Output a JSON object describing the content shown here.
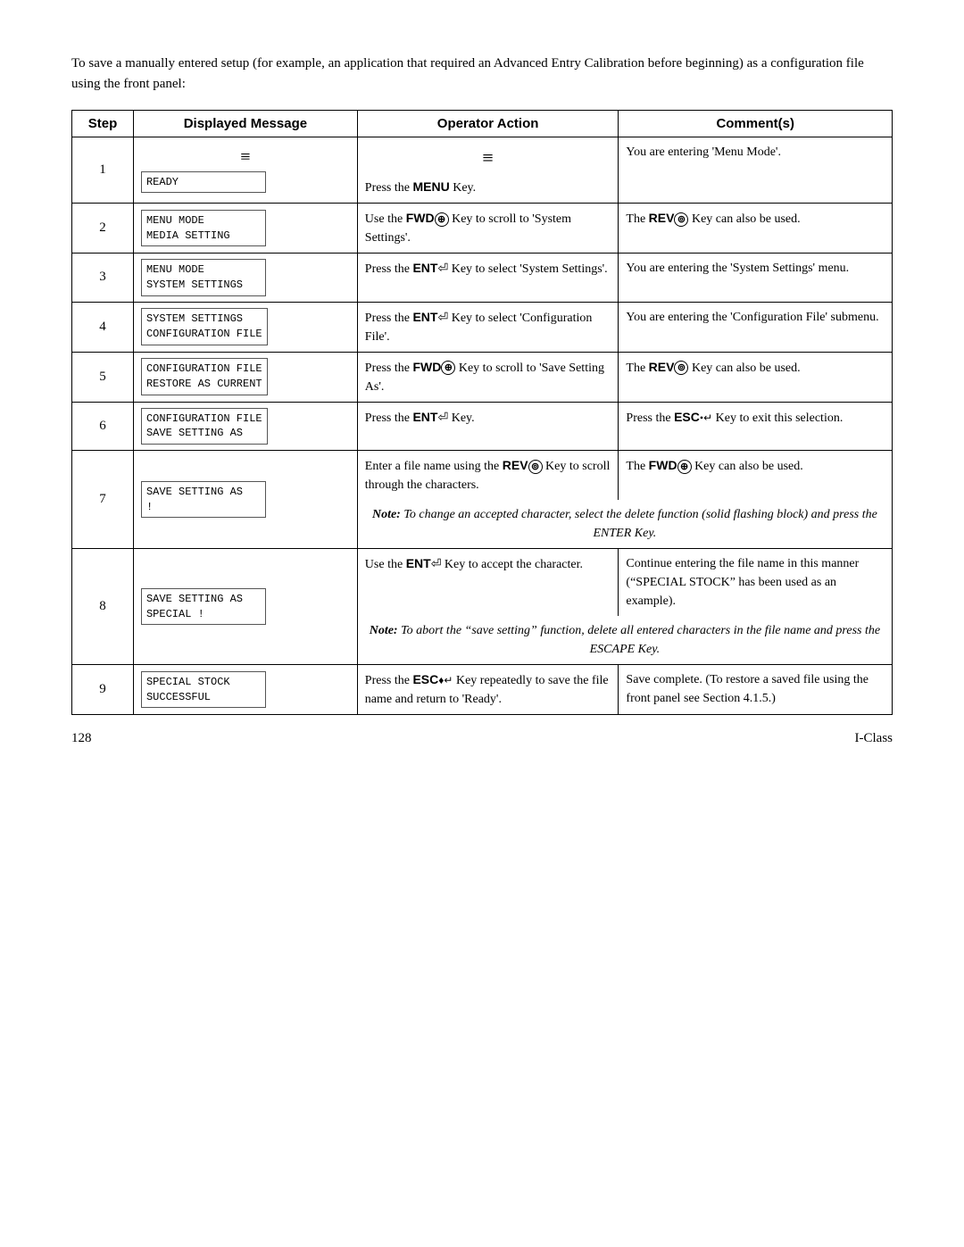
{
  "intro": {
    "text": "To save a manually entered setup (for example, an application that required an Advanced Entry Calibration before beginning) as a configuration file using the front panel:"
  },
  "table": {
    "headers": {
      "step": "Step",
      "display": "Displayed Message",
      "operator": "Operator Action",
      "comment": "Comment(s)"
    },
    "rows": [
      {
        "step": "1",
        "display_lines": [
          "READY"
        ],
        "operator": "Press the MENU Key.",
        "operator_prefix": "",
        "comment": "You are entering 'Menu Mode'.",
        "has_note": false
      },
      {
        "step": "2",
        "display_lines": [
          "MENU MODE",
          "MEDIA SETTING"
        ],
        "operator": "Use the FWD Key to scroll to 'System Settings'.",
        "comment": "The REV Key can also be used.",
        "has_note": false
      },
      {
        "step": "3",
        "display_lines": [
          "MENU MODE",
          "SYSTEM SETTINGS"
        ],
        "operator": "Press the ENT Key to select 'System Settings'.",
        "comment": "You are entering the 'System Settings' menu.",
        "has_note": false
      },
      {
        "step": "4",
        "display_lines": [
          "SYSTEM SETTINGS",
          "CONFIGURATION FILE"
        ],
        "operator": "Press the ENT Key to select 'Configuration File'.",
        "comment": "You are entering the 'Configuration File' submenu.",
        "has_note": false
      },
      {
        "step": "5",
        "display_lines": [
          "CONFIGURATION FILE",
          "RESTORE AS CURRENT"
        ],
        "operator": "Press the FWD Key to scroll to  'Save Setting As'.",
        "comment": "The REV Key can also be used.",
        "has_note": false
      },
      {
        "step": "6",
        "display_lines": [
          "CONFIGURATION FILE",
          "SAVE SETTING AS"
        ],
        "operator": "Press the ENT Key.",
        "comment": "Press the ESC Key to exit this selection.",
        "has_note": false
      },
      {
        "step": "7",
        "display_lines": [
          "SAVE SETTING AS",
          "!"
        ],
        "operator": "Enter a file name using the REV Key to scroll through the characters.",
        "comment": "The FWD Key can also be used.",
        "has_note": true,
        "note": "Note: To change an accepted character, select the delete function (solid flashing block) and press the ENTER Key."
      },
      {
        "step": "8",
        "display_lines": [
          "SAVE SETTING AS",
          "SPECIAL !"
        ],
        "operator": "Use the ENT Key to accept the character.",
        "comment": "Continue entering the file name in this manner (“SPECIAL STOCK” has been used as an example).",
        "has_note": true,
        "note": "Note: To abort the “save setting” function, delete all entered characters in the file name and press the ESCAPE Key."
      },
      {
        "step": "9",
        "display_lines": [
          "SPECIAL STOCK",
          "SUCCESSFUL"
        ],
        "operator": "Press the ESC Key repeatedly to save the file name and return to 'Ready'.",
        "comment": "Save complete. (To restore a saved file using the front panel see Section 4.1.5.)",
        "has_note": false
      }
    ]
  },
  "footer": {
    "page": "128",
    "product": "I-Class"
  }
}
